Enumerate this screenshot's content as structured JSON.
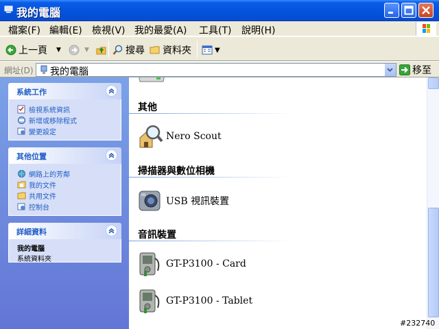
{
  "window": {
    "title": "我的電腦"
  },
  "menu": [
    "檔案(F)",
    "編輯(E)",
    "檢視(V)",
    "我的最愛(A)",
    "工具(T)",
    "說明(H)"
  ],
  "toolbar": {
    "back_label": "上一頁",
    "search_label": "搜尋",
    "folders_label": "資料夾"
  },
  "address": {
    "label": "網址(D)",
    "value": "我的電腦",
    "go_label": "移至"
  },
  "sidebar": {
    "system_tasks": {
      "title": "系統工作",
      "items": [
        "檢視系統資訊",
        "新增或移除程式",
        "變更設定"
      ]
    },
    "other_places": {
      "title": "其他位置",
      "items": [
        "網路上的芳鄰",
        "我的文件",
        "共用文件",
        "控制台"
      ]
    },
    "details": {
      "title": "詳細資料",
      "name": "我的電腦",
      "subtitle": "系統資料夾"
    }
  },
  "content": {
    "groups": [
      {
        "title": "其他",
        "items": [
          {
            "label": "Nero Scout",
            "icon": "nero-scout-icon"
          }
        ]
      },
      {
        "title": "掃描器與數位相機",
        "items": [
          {
            "label": "USB 視訊裝置",
            "icon": "webcam-icon"
          }
        ]
      },
      {
        "title": "音訊裝置",
        "items": [
          {
            "label": "GT-P3100 - Card",
            "icon": "media-player-icon"
          },
          {
            "label": "GT-P3100 - Tablet",
            "icon": "media-player-icon"
          }
        ]
      }
    ]
  },
  "watermark": "#232740"
}
